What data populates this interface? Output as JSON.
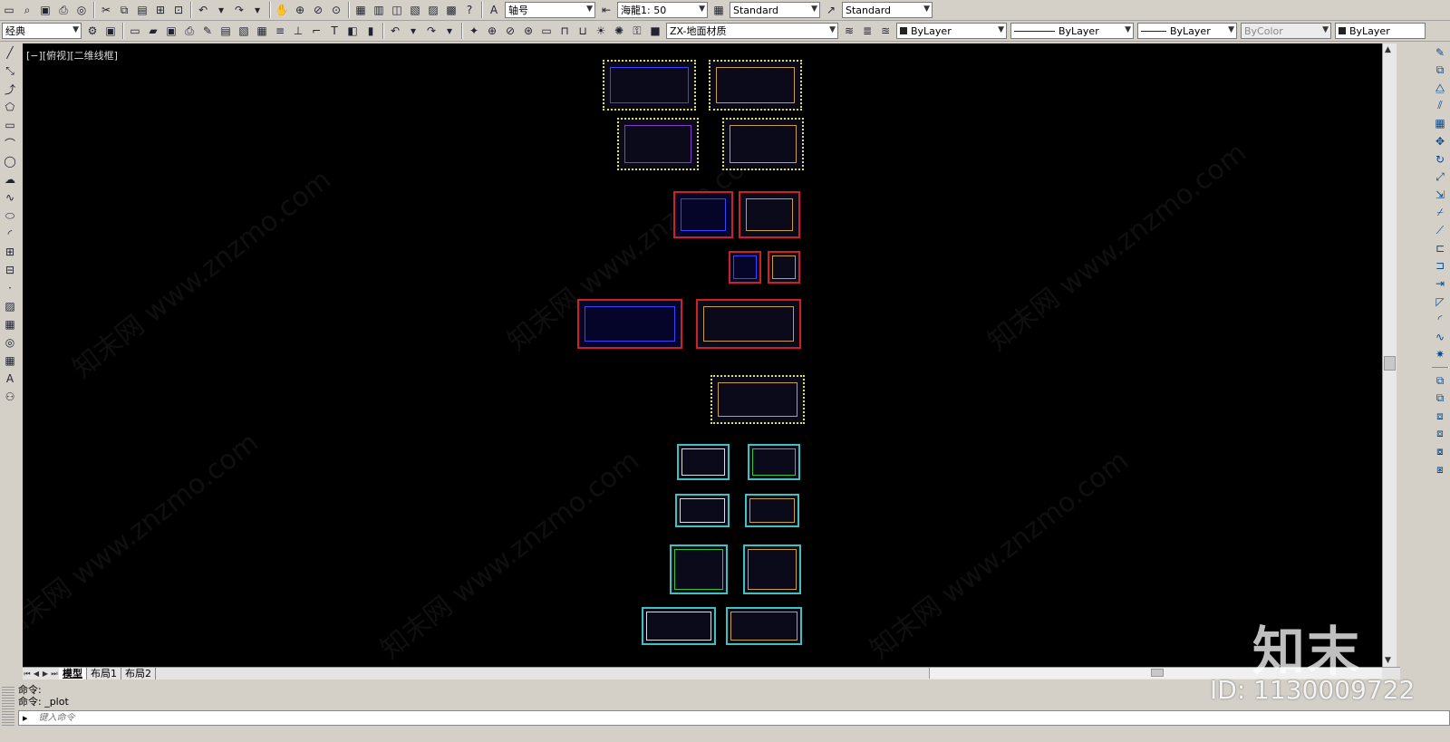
{
  "toolbar1": {
    "text_style_label": "轴号",
    "dim_scale_label": "海龍1: 50",
    "table_style_label": "Standard",
    "multileader_style_label": "Standard"
  },
  "toolbar2": {
    "workspace_label": "经典",
    "layer_label": "ZX-地面材质",
    "color_label": "ByLayer",
    "linetype_label": "ByLayer",
    "lineweight_label": "ByLayer",
    "plotstyle_label": "ByColor",
    "right_label": "ByLayer"
  },
  "viewport": {
    "label": "[−][俯视][二维线框]"
  },
  "tabs": [
    "模型",
    "布局1",
    "布局2"
  ],
  "command": {
    "history": [
      "命令:",
      "命令: _plot"
    ],
    "placeholder": "键入命令"
  },
  "watermark": {
    "logo": "知末",
    "id": "ID: 1130009722",
    "site": "知末网 www.znzmo.com"
  },
  "colors": {
    "canvas": "#000000",
    "toolbar": "#d4d0c8",
    "sheet_border_yellow": "#e0e060",
    "sheet_border_red": "#d02020",
    "sheet_border_cyan": "#40c0c0"
  }
}
